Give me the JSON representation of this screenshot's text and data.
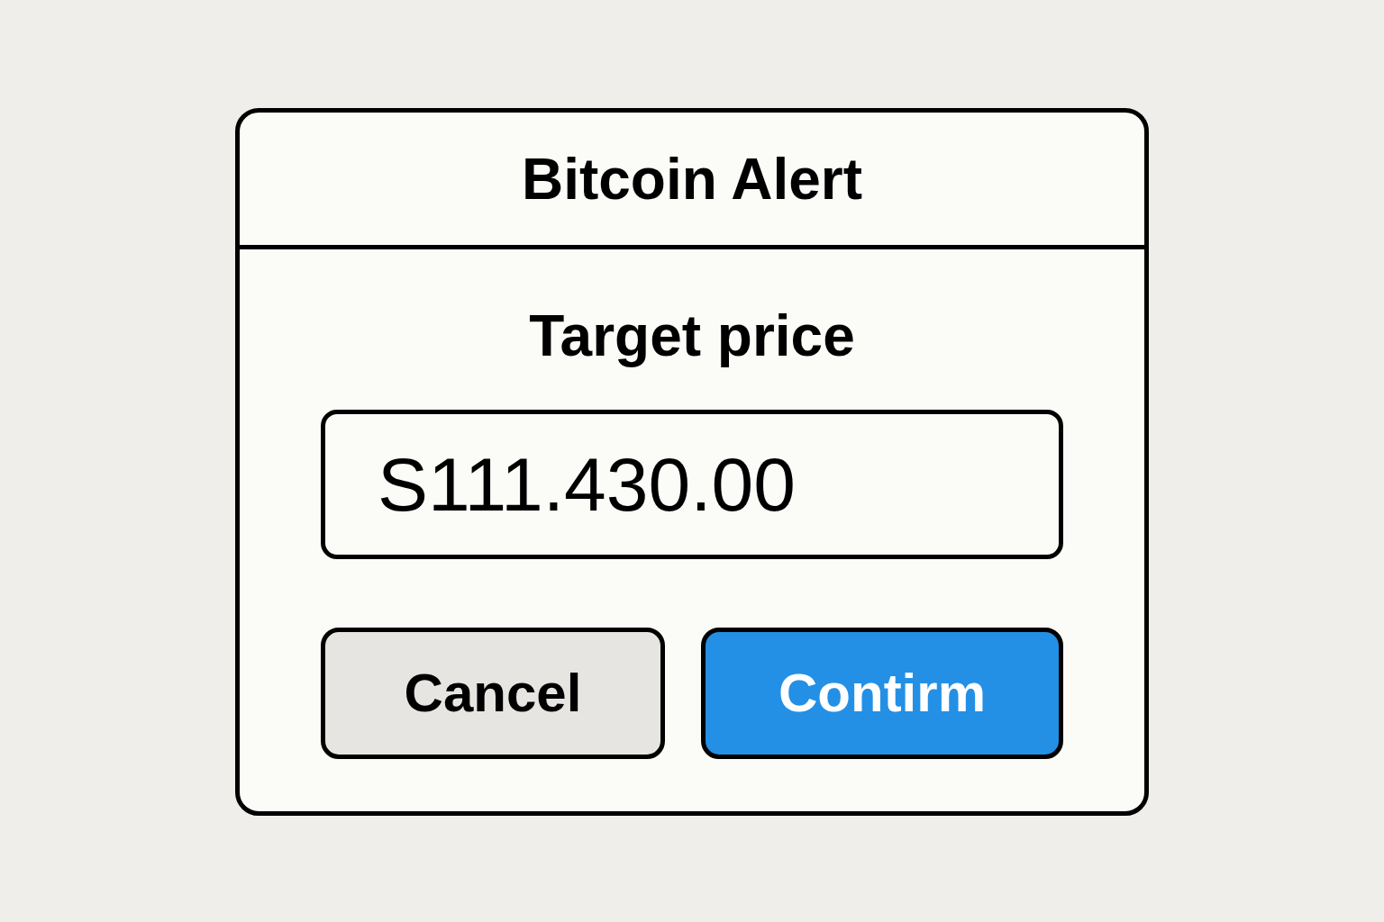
{
  "dialog": {
    "title": "Bitcoin Alert"
  },
  "field": {
    "label": "Target price",
    "value": "S111.430.00"
  },
  "buttons": [
    {
      "label": "Cancel",
      "kind": "secondary"
    },
    {
      "label": "Contirm",
      "kind": "primary"
    }
  ]
}
